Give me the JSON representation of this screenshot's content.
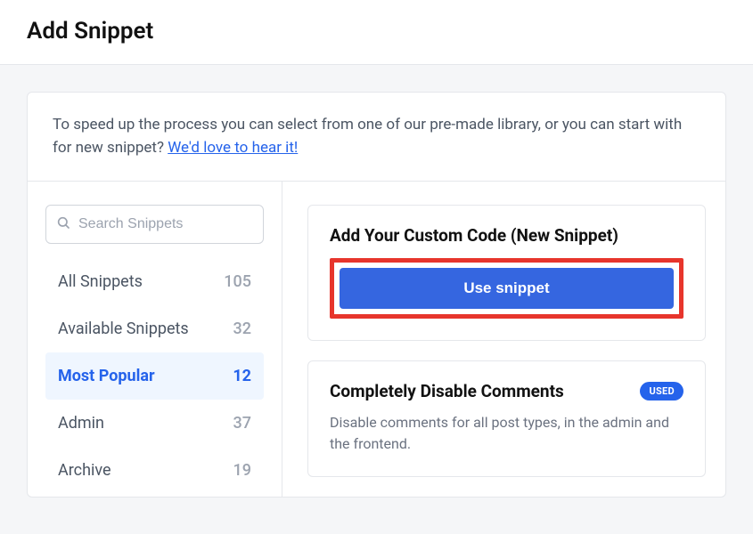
{
  "header": {
    "title": "Add Snippet"
  },
  "intro": {
    "text": "To speed up the process you can select from one of our pre-made library, or you can start with for new snippet? ",
    "link_text": "We'd love to hear it!"
  },
  "sidebar": {
    "search_placeholder": "Search Snippets",
    "items": [
      {
        "label": "All Snippets",
        "count": "105",
        "active": false
      },
      {
        "label": "Available Snippets",
        "count": "32",
        "active": false
      },
      {
        "label": "Most Popular",
        "count": "12",
        "active": true
      },
      {
        "label": "Admin",
        "count": "37",
        "active": false
      },
      {
        "label": "Archive",
        "count": "19",
        "active": false
      }
    ]
  },
  "content": {
    "card1": {
      "title": "Add Your Custom Code (New Snippet)",
      "button_label": "Use snippet"
    },
    "card2": {
      "title": "Completely Disable Comments",
      "badge": "USED",
      "description": "Disable comments for all post types, in the admin and the frontend."
    }
  }
}
